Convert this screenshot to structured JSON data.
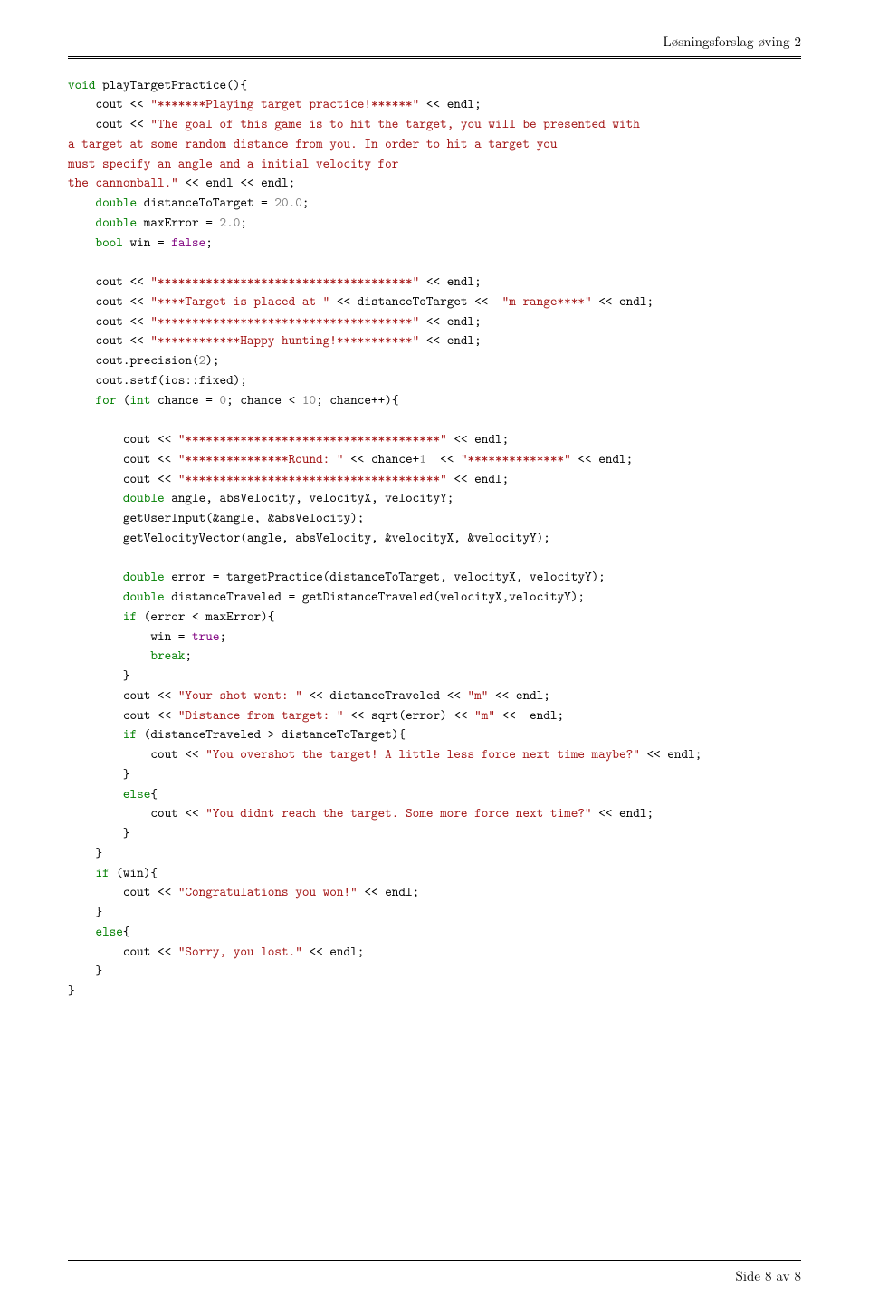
{
  "header": {
    "title": "Løsningsforslag øving 2"
  },
  "footer": {
    "page": "Side 8 av 8"
  },
  "code": {
    "fn_ret": "void",
    "fn_name": "playTargetPractice",
    "s_play": "\"*******Playing target practice!******\"",
    "s_endl": " << endl;",
    "s_goal": "\"The goal of this game is to hit the target, you will be presented with",
    "s_goal2": "a target at some random distance from you. In order to hit a target you",
    "s_goal3": "must specify an angle and a initial velocity for",
    "s_goal4": "the cannonball.\"",
    "dbl": "double",
    "bool_t": "bool",
    "int_t": "int",
    "for_t": "for",
    "if_t": "if",
    "else_t": "else",
    "break_t": "break",
    "true_t": "true",
    "false_t": "false",
    "n20": "20.0",
    "n2": "2.0",
    "n2b": "2",
    "n0": "0",
    "n10": "10",
    "n1": "1",
    "s_stars": "\"*************************************\"",
    "s_target": "\"****Target is placed at \"",
    "s_range": "\"m range****\"",
    "s_happy": "\"************Happy hunting!***********\"",
    "s_round": "\"***************Round: \"",
    "s_round2": "\"**************\"",
    "s_shot": "\"Your shot went: \"",
    "s_m": "\"m\"",
    "s_dist": "\"Distance from target: \"",
    "s_overshot": "\"You overshot the target! A little less force next time maybe?\"",
    "s_didnt": "\"You didnt reach the target. Some more force next time?\"",
    "s_congrats": "\"Congratulations you won!\"",
    "s_sorry": "\"Sorry, you lost.\""
  }
}
